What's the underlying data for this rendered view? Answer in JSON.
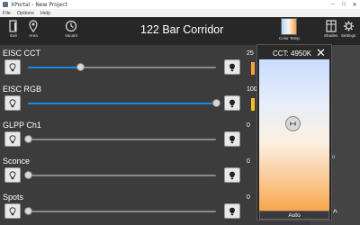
{
  "window": {
    "title": "XPortal - New Project"
  },
  "menu": [
    "File",
    "Options",
    "Help"
  ],
  "toolbar": {
    "tools": [
      {
        "label": "Exit",
        "icon": "exit-icon"
      },
      {
        "label": "Area",
        "icon": "location-pin-icon"
      },
      {
        "label": "Vacant",
        "icon": "clock-icon"
      }
    ],
    "room_title": "122 Bar Corridor",
    "right_tools": [
      {
        "label": "Color Temp",
        "icon": "color-temp-swatch"
      },
      {
        "label": "Shades",
        "icon": "shades-icon"
      },
      {
        "label": "Settings",
        "icon": "gear-icon"
      }
    ]
  },
  "channels": [
    {
      "name": "EISC CCT",
      "value": "25",
      "level": 0.28,
      "bar_color": "#f7a040"
    },
    {
      "name": "EISC RGB",
      "value": "100",
      "level": 1.0,
      "bar_color": "#f7c020"
    },
    {
      "name": "GLPP Ch1",
      "value": "0",
      "level": 0.0,
      "bar_color": ""
    },
    {
      "name": "Sconce",
      "value": "0",
      "level": 0.0,
      "bar_color": ""
    },
    {
      "name": "Spots",
      "value": "0",
      "level": 0.0,
      "bar_color": ""
    }
  ],
  "popup": {
    "title": "CCT: 4950K",
    "close": "✕",
    "auto_label": "Auto",
    "handle_level": 0.42
  },
  "right_panel": {
    "text": "o",
    "chevron": "^"
  },
  "colors": {
    "accent": "#1e88e5",
    "background": "#3c3c3c",
    "toolbar": "#272727"
  }
}
